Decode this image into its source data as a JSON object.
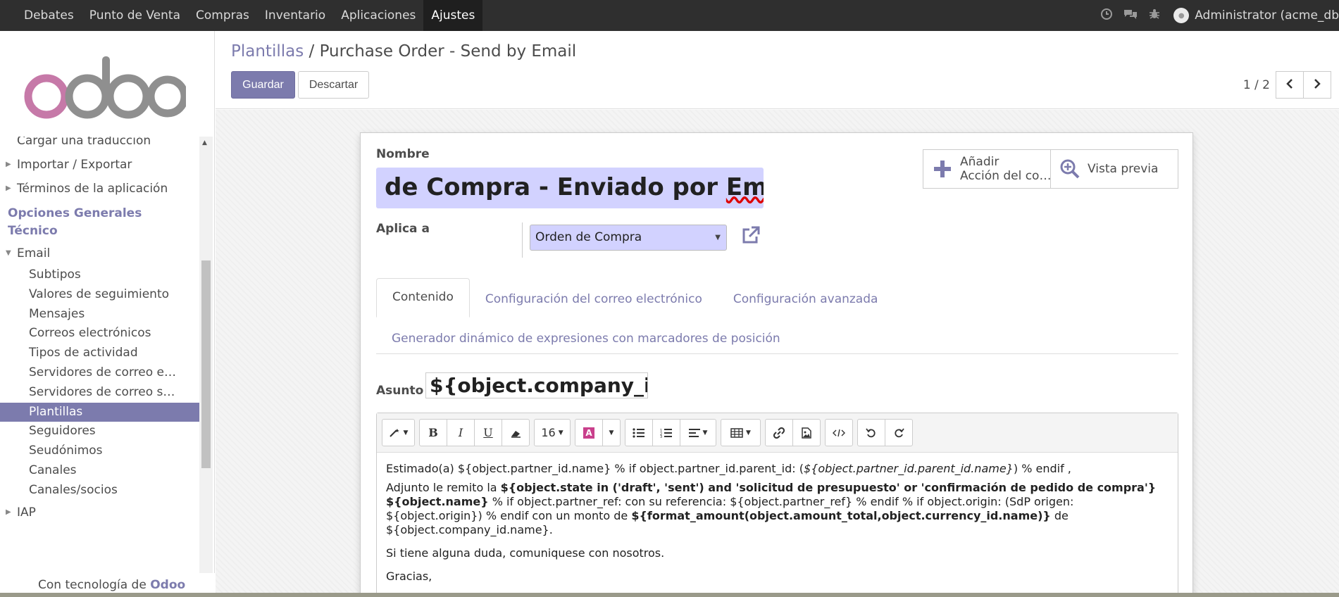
{
  "topbar": {
    "menu": [
      "Debates",
      "Punto de Venta",
      "Compras",
      "Inventario",
      "Aplicaciones",
      "Ajustes"
    ],
    "active_index": 5,
    "icons": [
      "clock-icon",
      "chat-icon",
      "bug-icon"
    ],
    "user": "Administrator (acme_db"
  },
  "sidebar": {
    "logo_text": "odoo",
    "items_top": [
      {
        "label": "Cargar una traducción",
        "caret": false
      },
      {
        "label": "Importar / Exportar",
        "caret": true
      },
      {
        "label": "Términos de la aplicación",
        "caret": true
      }
    ],
    "section": [
      "Opciones Generales",
      "Técnico"
    ],
    "email_label": "Email",
    "email_items": [
      "Subtipos",
      "Valores de seguimiento",
      "Mensajes",
      "Correos electrónicos",
      "Tipos de actividad",
      "Servidores de correo e…",
      "Servidores de correo s…",
      "Plantillas",
      "Seguidores",
      "Seudónimos",
      "Canales",
      "Canales/socios"
    ],
    "active_item": "Plantillas",
    "iap_label": "IAP",
    "powered_prefix": "Con tecnología de",
    "powered_brand": "Odoo"
  },
  "control": {
    "breadcrumb_parent": "Plantillas",
    "breadcrumb_sep": "/",
    "breadcrumb_current": "Purchase Order - Send by Email",
    "save_label": "Guardar",
    "discard_label": "Descartar",
    "pager_value": "1 / 2"
  },
  "form": {
    "name_label": "Nombre",
    "name_value_prefix": "de Compra - Enviado por ",
    "name_value_misspelled": "Email",
    "smart_add_line1": "Añadir",
    "smart_add_line2": "Acción del co…",
    "smart_preview": "Vista previa",
    "applies_label": "Aplica a",
    "applies_value": "Orden de Compra",
    "tabs": [
      "Contenido",
      "Configuración del correo electrónico",
      "Configuración avanzada"
    ],
    "tab2": "Generador dinámico de expresiones con marcadores de posición",
    "active_tab": "Contenido",
    "subject_label": "Asunto",
    "subject_value": "${object.company_id.na",
    "font_size": "16"
  },
  "body": {
    "p1_a": "Estimado(a) ${object.partner_id.name} % if object.partner_id.parent_id: (",
    "p1_i": "${object.partner_id.parent_id.name}",
    "p1_b": ") % endif ,",
    "p2_a": "Adjunto le remito la ",
    "p2_b1": "${object.state in ('draft', 'sent') and 'solicitud de presupuesto' or 'confirmación de pedido de compra'} ${object.name}",
    "p2_c": " % if object.partner_ref: con su referencia: ${object.partner_ref} % endif % if object.origin: (SdP origen: ${object.origin}) % endif con un monto de ",
    "p2_b2": "${format_amount(object.amount_total,object.currency_id.name)}",
    "p2_d": " de ${object.company_id.name}.",
    "p3": "Si tiene alguna duda, comuniquese con nosotros.",
    "p4": "Gracias,"
  },
  "colors": {
    "brand": "#7c7bad",
    "topbar": "#2f2f2f",
    "input_required": "#d2d2ff"
  }
}
